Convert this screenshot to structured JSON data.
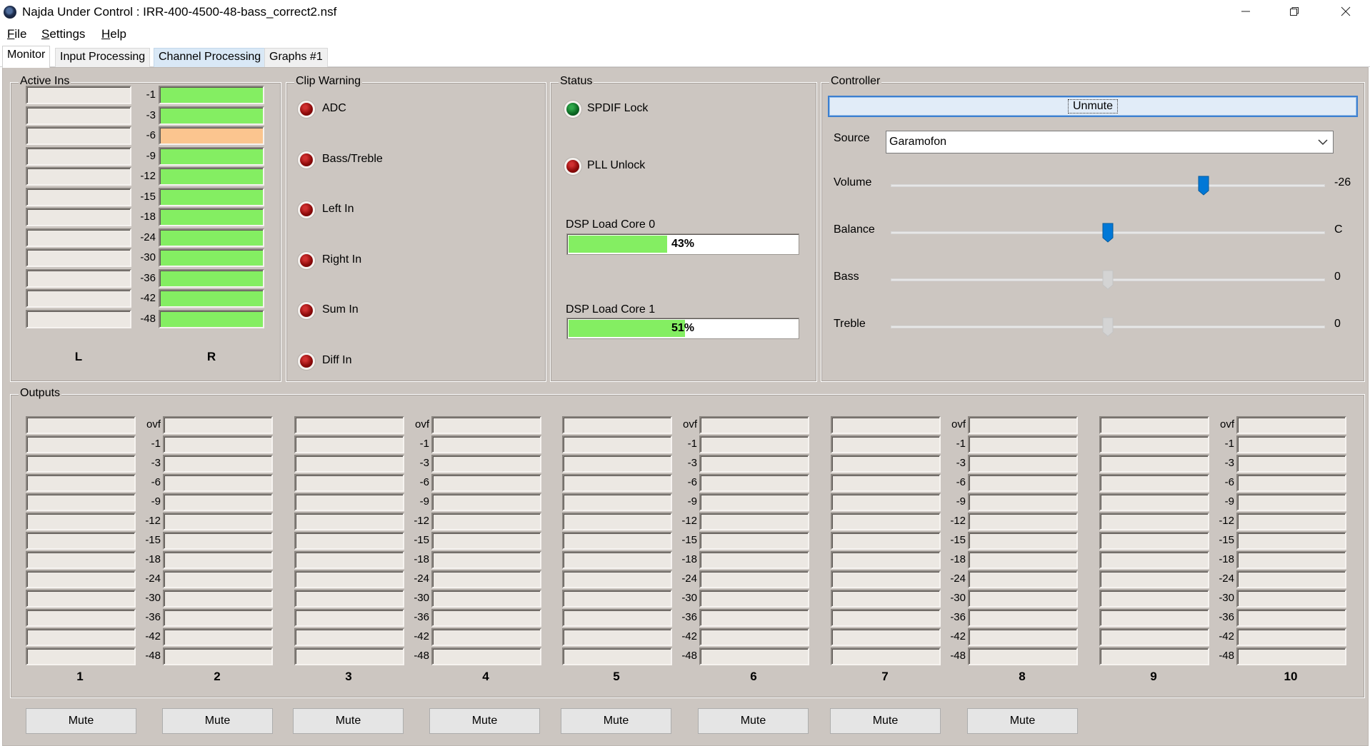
{
  "window": {
    "title": "Najda Under Control : IRR-400-4500-48-bass_correct2.nsf",
    "icon": "app-disc-icon",
    "controls": [
      "minimize-icon",
      "restore-icon",
      "close-icon"
    ]
  },
  "menu": [
    {
      "accel": "F",
      "rest": "ile"
    },
    {
      "accel": "S",
      "rest": "ettings"
    },
    {
      "accel": "H",
      "rest": "elp"
    }
  ],
  "tabs": [
    {
      "label": "Monitor",
      "state": "active"
    },
    {
      "label": "Input Processing",
      "state": "inactive"
    },
    {
      "label": "Channel Processing",
      "state": "highlighted"
    },
    {
      "label": "Graphs #1",
      "state": "inactive"
    }
  ],
  "active_ins": {
    "title": "Active Ins",
    "scale": [
      "-1",
      "-3",
      "-6",
      "-9",
      "-12",
      "-15",
      "-18",
      "-24",
      "-30",
      "-36",
      "-42",
      "-48"
    ],
    "channels": [
      {
        "label": "L",
        "lit": 0
      },
      {
        "label": "R",
        "lit": 12
      }
    ],
    "colors": {
      "off": "#ece8e3",
      "normal": "#84ee62",
      "warning": "#fbc58f"
    }
  },
  "clip_warning": {
    "title": "Clip Warning",
    "items": [
      "ADC",
      "Bass/Treble",
      "Left In",
      "Right In",
      "Sum In",
      "Diff In"
    ],
    "led_color": "#8f0b0b"
  },
  "status": {
    "title": "Status",
    "leds": [
      {
        "label": "SPDIF Lock",
        "color": "green"
      },
      {
        "label": "PLL Unlock",
        "color": "red"
      }
    ],
    "loads": [
      {
        "label": "DSP Load Core 0",
        "percent": 43,
        "text": "43%"
      },
      {
        "label": "DSP Load Core 1",
        "percent": 51,
        "text": "51%"
      }
    ]
  },
  "controller": {
    "title": "Controller",
    "unmute_label": "Unmute",
    "source_label": "Source",
    "source_value": "Garamofon",
    "sliders": [
      {
        "label": "Volume",
        "value_text": "-26",
        "position": 0.72,
        "enabled": true
      },
      {
        "label": "Balance",
        "value_text": "C",
        "position": 0.5,
        "enabled": true
      },
      {
        "label": "Bass",
        "value_text": "0",
        "position": 0.5,
        "enabled": false
      },
      {
        "label": "Treble",
        "value_text": "0",
        "position": 0.5,
        "enabled": false
      }
    ]
  },
  "outputs": {
    "title": "Outputs",
    "scale": [
      "ovf",
      "-1",
      "-3",
      "-6",
      "-9",
      "-12",
      "-15",
      "-18",
      "-24",
      "-30",
      "-36",
      "-42",
      "-48"
    ],
    "channels": [
      "1",
      "2",
      "3",
      "4",
      "5",
      "6",
      "7",
      "8",
      "9",
      "10"
    ],
    "mute_label": "Mute",
    "mute_count": 8
  }
}
